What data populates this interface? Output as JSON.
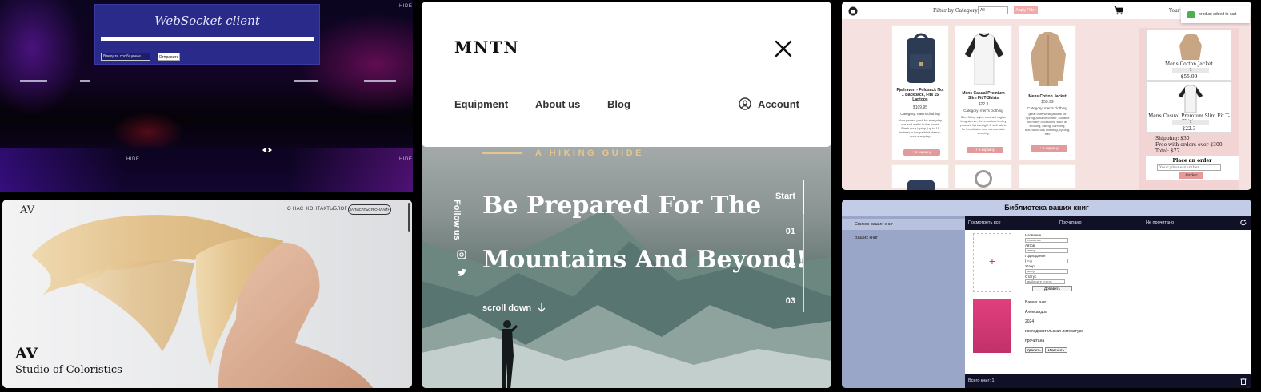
{
  "websocket": {
    "title": "WebSocket client",
    "input_placeholder": "Введите сообщение",
    "send_label": "Отправить",
    "hide_labels": [
      "HIDE",
      "HIDE",
      "HIDE",
      "HIDE"
    ]
  },
  "studio": {
    "logo": "AV",
    "nav": [
      "О НАС",
      "КОНТАКТЫ",
      "БЛОГ"
    ],
    "signup_label": "ЗАПИСАТЬСЯ ОНЛАЙН",
    "brand": "AV",
    "tagline": "Studio of Coloristics"
  },
  "mntn": {
    "brand": "MNTN",
    "menu": [
      "Equipment",
      "About us",
      "Blog"
    ],
    "account_label": "Account",
    "guide": "A HIKING GUIDE",
    "follow": "Follow us",
    "headline_1": "Be Prepared For The",
    "headline_2": "Mountains And Beyond!",
    "scroll_down": "scroll down",
    "sidenav": [
      "Start",
      "01",
      "02",
      "03"
    ]
  },
  "shop": {
    "filter_label": "Filter by Category:",
    "filter_value": "All",
    "apply_label": "Apply Filter",
    "your_label": "Your S",
    "toast": "product added to cart",
    "products": [
      {
        "title": "Fjallraven - Foldsack No. 1 Backpack, Fits 15 Laptops",
        "price": "$109.95",
        "category": "Category: men's clothing",
        "desc": "Your perfect pack for everyday use and walks in the forest. Stash your laptop (up to 15 inches) in the padded sleeve, your everyday",
        "add": "+ в корзину"
      },
      {
        "title": "Mens Casual Premium Slim Fit T-Shirts",
        "price": "$22.3",
        "category": "Category: men's clothing",
        "desc": "Slim-fitting style, contrast raglan long sleeve, three-button henley placket, light weight & soft fabric for breathable and comfortable wearing.",
        "add": "+ в корзину"
      },
      {
        "title": "Mens Cotton Jacket",
        "price": "$55.99",
        "category": "Category: men's clothing",
        "desc": "great outerwear jackets for Spring/Autumn/Winter, suitable for many occasions, such as working, hiking, camping, mountain/rock climbing, cycling, trav",
        "add": "+ в корзину"
      }
    ],
    "cart_items": [
      {
        "name": "Mens Cotton Jacket",
        "qty": "1",
        "price": "$55.99"
      },
      {
        "name": "Mens Casual Premium Slim Fit T-Shirts",
        "qty": "1",
        "price": "$22.3"
      }
    ],
    "shipping": "Shipping: $30",
    "free_shipping": "Free with orders over $300",
    "total": "Total: $77",
    "place_order": "Place an order",
    "phone_placeholder": "Your phone number",
    "order_label": "Order"
  },
  "library": {
    "title": "Библиотека ваших книг",
    "sidebar": [
      "Список ваших книг",
      "Ваших книг"
    ],
    "tabs": [
      "Посмотреть все",
      "Прочитано",
      "Не прочитано"
    ],
    "form_labels": [
      "Название",
      "Автор",
      "Год издания",
      "Жанр",
      "Статус"
    ],
    "form_values": [
      "название",
      "автор",
      "год",
      "жанр",
      "выберите статус"
    ],
    "add_label": "Добавить",
    "book": {
      "title": "Ваших книг",
      "author": "Александра",
      "year": "2024",
      "genre": "исследовательская литература",
      "status": "прочитана"
    },
    "delete_label": "Удалить",
    "edit_label": "Изменить",
    "total": "Всего книг: 1"
  }
}
